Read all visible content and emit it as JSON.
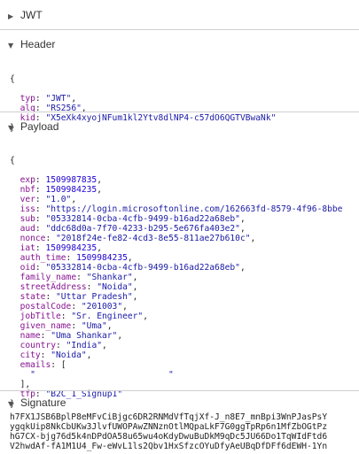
{
  "sections": {
    "jwt": {
      "title": "JWT"
    },
    "header": {
      "title": "Header"
    },
    "payload": {
      "title": "Payload"
    },
    "signature": {
      "title": "Signature"
    }
  },
  "header": {
    "open": "{",
    "close": "}",
    "fields": [
      {
        "key": "typ",
        "value": "\"JWT\"",
        "comma": ","
      },
      {
        "key": "alg",
        "value": "\"RS256\"",
        "comma": ","
      },
      {
        "key": "kid",
        "value": "\"X5eXk4xyojNFum1kl2Ytv8dlNP4-c57dO6QGTVBwaNk\"",
        "comma": ""
      }
    ]
  },
  "payload": {
    "open": "{",
    "fields": [
      {
        "key": "exp",
        "value": "1509987835",
        "comma": ","
      },
      {
        "key": "nbf",
        "value": "1509984235",
        "comma": ","
      },
      {
        "key": "ver",
        "value": "\"1.0\"",
        "comma": ","
      },
      {
        "key": "iss",
        "value": "\"https://login.microsoftonline.com/162663fd-8579-4f96-8bbe",
        "comma": ""
      },
      {
        "key": "sub",
        "value": "\"05332814-0cba-4cfb-9499-b16ad22a68eb\"",
        "comma": ","
      },
      {
        "key": "aud",
        "value": "\"ddc68d0a-7f70-4233-b295-5e676fa403e2\"",
        "comma": ","
      },
      {
        "key": "nonce",
        "value": "\"2018f24e-fe82-4cd3-8e55-811ae27b610c\"",
        "comma": ","
      },
      {
        "key": "iat",
        "value": "1509984235",
        "comma": ","
      },
      {
        "key": "auth_time",
        "value": "1509984235",
        "comma": ","
      },
      {
        "key": "oid",
        "value": "\"05332814-0cba-4cfb-9499-b16ad22a68eb\"",
        "comma": ","
      },
      {
        "key": "family_name",
        "value": "\"Shankar\"",
        "comma": ","
      },
      {
        "key": "streetAddress",
        "value": "\"Noida\"",
        "comma": ","
      },
      {
        "key": "state",
        "value": "\"Uttar Pradesh\"",
        "comma": ","
      },
      {
        "key": "postalCode",
        "value": "\"201003\"",
        "comma": ","
      },
      {
        "key": "jobTitle",
        "value": "\"Sr. Engineer\"",
        "comma": ","
      },
      {
        "key": "given_name",
        "value": "\"Uma\"",
        "comma": ","
      },
      {
        "key": "name",
        "value": "\"Uma Shankar\"",
        "comma": ","
      },
      {
        "key": "country",
        "value": "\"India\"",
        "comma": ","
      },
      {
        "key": "city",
        "value": "\"Noida\"",
        "comma": ","
      },
      {
        "key": "emails",
        "value": "[",
        "comma": ""
      }
    ],
    "email_value": "\"                          \"",
    "emails_close": "],",
    "tfp": {
      "key": "tfp",
      "value": "\"B2C_1_Signup1\"",
      "comma": ""
    },
    "close": "}"
  },
  "signature": {
    "lines": [
      "h7FX1JSB6BplP8eMFvCiBjgc6DR2RNMdVfTqjXf-J_n8E7_mnBpi3WnPJasPsY",
      "ygqkUip8NkCbUKw3JlvfUWOPAwZNNznOtlMQpaLkF7G0ggTpRp6n1MfZbOGtPz",
      "hG7CX-bjg76d5k4nDPdOA58u65wu4oKdyDwuBuDkM9qDc5JU66Do1TqWIdFtd6",
      "V2hwdAf-fA1M1U4_Fw-eWvL1ls2Qbv1HxSfzcOYuDfyAeUBqDfDFf6dEWH-1Yn"
    ]
  }
}
